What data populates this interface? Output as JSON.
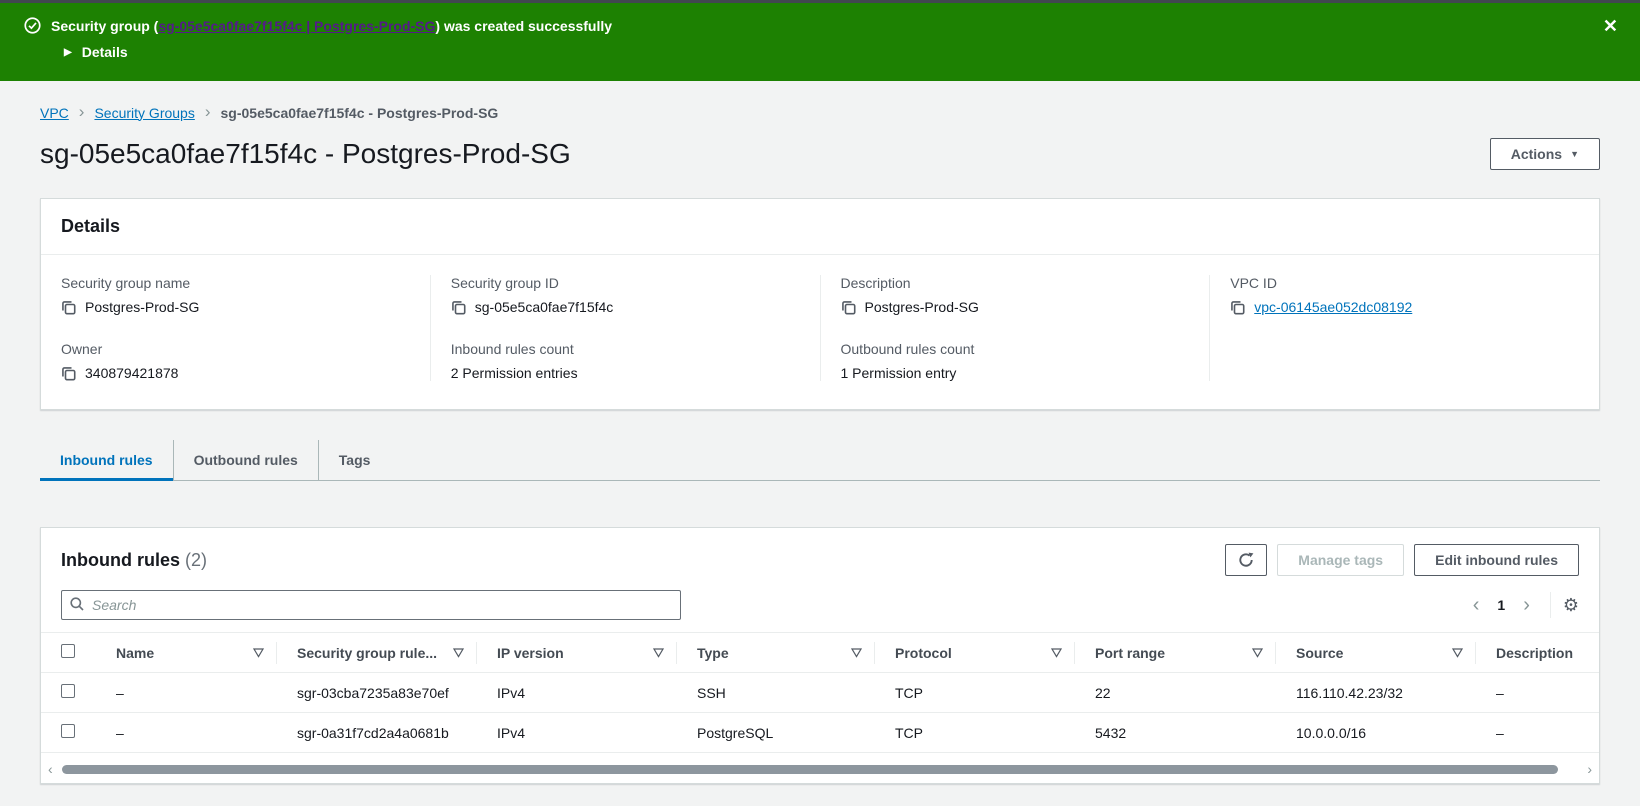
{
  "colors": {
    "flashbar_green": "#1d8102",
    "link_blue": "#0073bb",
    "visited_link_purple": "#551a8b",
    "text_dark": "#16191f",
    "text_gray": "#545b64"
  },
  "icons": {
    "close": "✕",
    "details_caret": "▶",
    "actions_caret": "▼",
    "breadcrumb_separator": "›",
    "pager_prev": "‹",
    "pager_next": "›",
    "gear": "⚙",
    "hscroll_left": "◄",
    "hscroll_right": "►"
  },
  "flashbar": {
    "message_prefix": "Security group (",
    "link_text": "sg-05e5ca0fae7f15f4c | Postgres-Prod-SG",
    "message_suffix": ") was created successfully",
    "details_label": "Details"
  },
  "breadcrumb": {
    "items": [
      {
        "label": "VPC"
      },
      {
        "label": "Security Groups"
      },
      {
        "label": "sg-05e5ca0fae7f15f4c - Postgres-Prod-SG"
      }
    ]
  },
  "header": {
    "title": "sg-05e5ca0fae7f15f4c - Postgres-Prod-SG",
    "actions_label": "Actions"
  },
  "details": {
    "title": "Details",
    "columns": [
      {
        "fields": [
          {
            "label": "Security group name",
            "value": "Postgres-Prod-SG"
          },
          {
            "label": "Owner",
            "value": "340879421878"
          }
        ]
      },
      {
        "fields": [
          {
            "label": "Security group ID",
            "value": "sg-05e5ca0fae7f15f4c"
          },
          {
            "label": "Inbound rules count",
            "value": "2 Permission entries"
          }
        ]
      },
      {
        "fields": [
          {
            "label": "Description",
            "value": "Postgres-Prod-SG"
          },
          {
            "label": "Outbound rules count",
            "value": "1 Permission entry"
          }
        ]
      },
      {
        "fields": [
          {
            "label": "VPC ID",
            "value": "vpc-06145ae052dc08192"
          }
        ]
      }
    ]
  },
  "tabs": [
    {
      "label": "Inbound rules"
    },
    {
      "label": "Outbound rules"
    },
    {
      "label": "Tags"
    }
  ],
  "table_panel": {
    "title": "Inbound rules",
    "count": "(2)",
    "manage_tags_label": "Manage tags",
    "edit_button_label": "Edit inbound rules",
    "search_placeholder": "Search",
    "page_number": "1",
    "columns": {
      "name": "Name",
      "sg_rule_id": "Security group rule...",
      "ip_version": "IP version",
      "type": "Type",
      "protocol": "Protocol",
      "port_range": "Port range",
      "source": "Source",
      "description": "Description"
    },
    "rows": [
      {
        "name": "–",
        "sg_rule_id": "sgr-03cba7235a83e70ef",
        "ip_version": "IPv4",
        "type": "SSH",
        "protocol": "TCP",
        "port_range": "22",
        "source": "116.110.42.23/32",
        "description": "–"
      },
      {
        "name": "–",
        "sg_rule_id": "sgr-0a31f7cd2a4a0681b",
        "ip_version": "IPv4",
        "type": "PostgreSQL",
        "protocol": "TCP",
        "port_range": "5432",
        "source": "10.0.0.0/16",
        "description": "–"
      }
    ]
  }
}
